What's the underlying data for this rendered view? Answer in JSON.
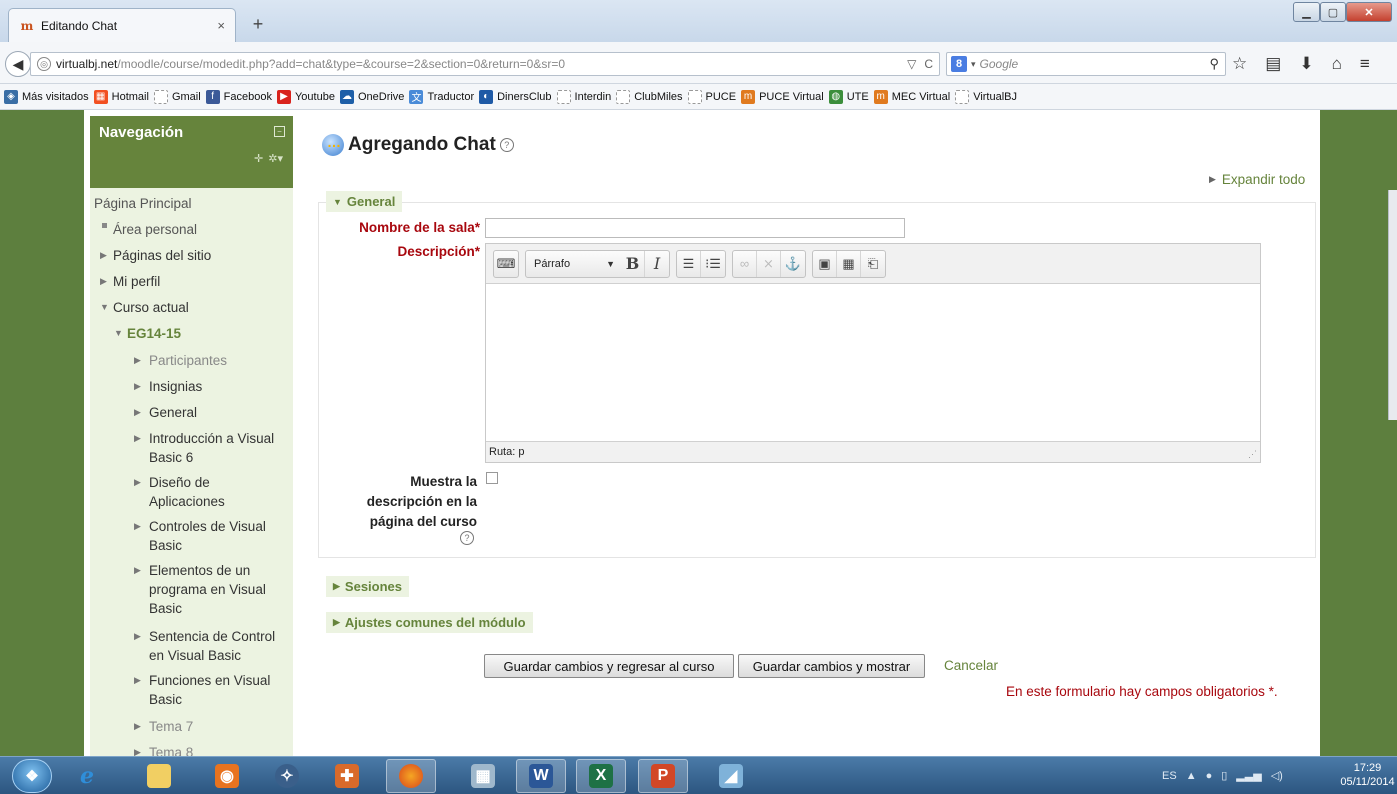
{
  "browser": {
    "tab_title": "Editando Chat",
    "tab_close": "×",
    "new_tab": "+",
    "url_host": "virtualbj.net",
    "url_path": "/moodle/course/modedit.php?add=chat&type=&course=2&section=0&return=0&sr=0",
    "search_engine_letter": "8",
    "search_placeholder": "Google"
  },
  "bookmarks": [
    {
      "label": "Más visitados",
      "color": "#3a6ea5",
      "glyph": "◈"
    },
    {
      "label": "Hotmail",
      "color": "#f25022",
      "glyph": "▦"
    },
    {
      "label": "Gmail",
      "color": "#ffffff",
      "glyph": ""
    },
    {
      "label": "Facebook",
      "color": "#3b5998",
      "glyph": "f"
    },
    {
      "label": "Youtube",
      "color": "#d9231d",
      "glyph": "▶"
    },
    {
      "label": "OneDrive",
      "color": "#1e5fa8",
      "glyph": "☁"
    },
    {
      "label": "Traductor",
      "color": "#4a8bd8",
      "glyph": "文"
    },
    {
      "label": "DinersClub",
      "color": "#1f5aa6",
      "glyph": "◐"
    },
    {
      "label": "Interdin",
      "color": "#ffffff",
      "glyph": ""
    },
    {
      "label": "ClubMiles",
      "color": "#ffffff",
      "glyph": ""
    },
    {
      "label": "PUCE",
      "color": "#ffffff",
      "glyph": ""
    },
    {
      "label": "PUCE Virtual",
      "color": "#e07a1f",
      "glyph": "m"
    },
    {
      "label": "UTE",
      "color": "#3c8e3c",
      "glyph": "◍"
    },
    {
      "label": "MEC Virtual",
      "color": "#e07a1f",
      "glyph": "m"
    },
    {
      "label": "VirtualBJ",
      "color": "#ffffff",
      "glyph": ""
    }
  ],
  "nav": {
    "title": "Navegación",
    "home": "Página Principal",
    "area_personal": "Área personal",
    "paginas_sitio": "Páginas del sitio",
    "mi_perfil": "Mi perfil",
    "curso_actual": "Curso actual",
    "course_code": "EG14-15",
    "items": [
      "Participantes",
      "Insignias",
      "General",
      "Introducción a Visual",
      "Basic 6",
      "Diseño de",
      "Aplicaciones",
      "Controles de Visual",
      "Basic",
      "Elementos de un",
      "programa en Visual",
      "Basic",
      "Sentencia de Control",
      "en Visual Basic",
      "Funciones en Visual",
      "Basic",
      "Tema 7",
      "Tema 8"
    ]
  },
  "main": {
    "title": "Agregando Chat",
    "expand_all": "Expandir todo",
    "section_general": "General",
    "field_name_label": "Nombre de la sala",
    "field_desc_label": "Descripción",
    "required_star": "*",
    "editor_format": "Párrafo",
    "editor_path": "Ruta: p",
    "show_desc_line1": "Muestra la",
    "show_desc_line2": "descripción en la",
    "show_desc_line3": "página del curso",
    "section_sesiones": "Sesiones",
    "section_ajustes": "Ajustes comunes del módulo",
    "btn_save_return": "Guardar cambios y regresar al curso",
    "btn_save_show": "Guardar cambios y mostrar",
    "cancel": "Cancelar",
    "required_note": "En este formulario hay campos obligatorios",
    "required_note_end": "."
  },
  "taskbar": {
    "lang": "ES",
    "time": "17:29",
    "date": "05/11/2014"
  },
  "colors": {
    "moodle_green": "#66843c",
    "required_red": "#a8070e",
    "page_bg": "#5d7f3e"
  }
}
